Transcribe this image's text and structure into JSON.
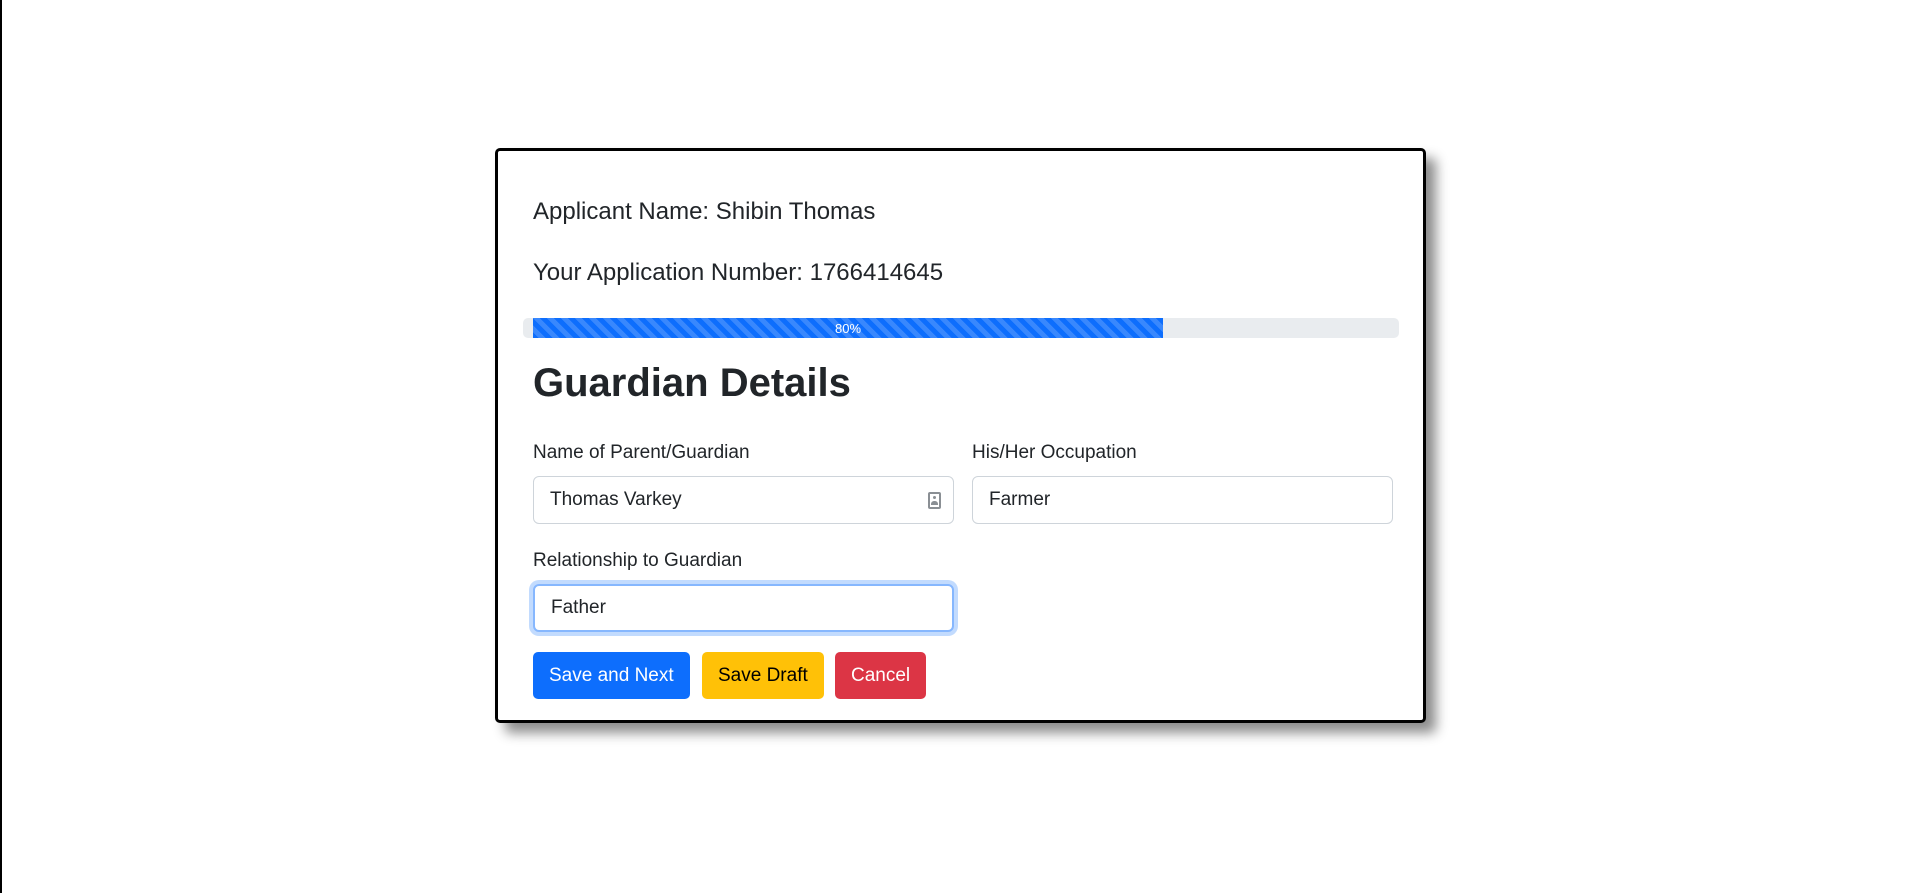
{
  "applicant": {
    "name_line": "Applicant Name: Shibin Thomas",
    "number_line": "Your Application Number: 1766414645"
  },
  "progress": {
    "value_percent": 80,
    "label": "80%"
  },
  "section": {
    "title": "Guardian Details"
  },
  "form": {
    "guardian_name": {
      "label": "Name of Parent/Guardian",
      "value": "Thomas Varkey",
      "icon": "contact-card-icon"
    },
    "occupation": {
      "label": "His/Her Occupation",
      "value": "Farmer"
    },
    "relationship": {
      "label": "Relationship to Guardian",
      "value": "Father"
    }
  },
  "buttons": {
    "save_next": "Save and Next",
    "save_draft": "Save Draft",
    "cancel": "Cancel"
  },
  "colors": {
    "primary": "#0d6efd",
    "warning": "#ffc107",
    "danger": "#dc3545",
    "progress_track": "#e9ecef"
  }
}
